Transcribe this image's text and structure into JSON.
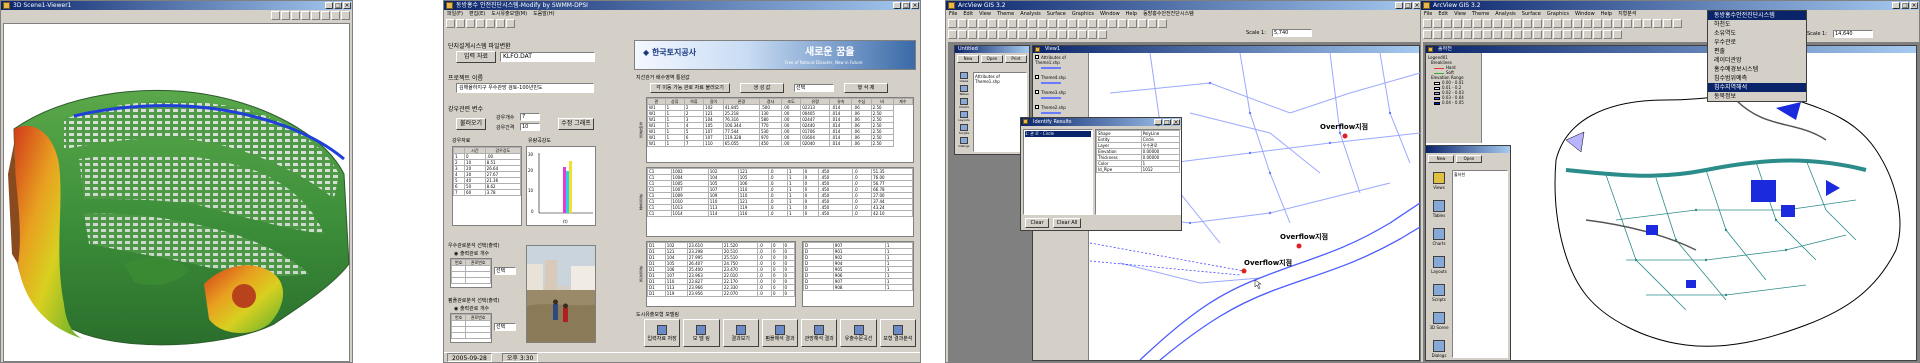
{
  "scene3d": {
    "title": "3D Scene1-Viewer1"
  },
  "swmm": {
    "title": "동방홍수 안전진단시스템-Modify by SWMM-DPSI",
    "menu": [
      "파일(F)",
      "편집(E)",
      "도시유출모델(M)",
      "도움말(H)"
    ],
    "input_section": "단지설계시스템 파일변환",
    "input_button": "입력 자료",
    "input_value": "KLFO.DAT",
    "project_name_label": "프로젝트 이름",
    "project_name_value": "김해율하지구 우수관망 검토-100년빈도",
    "rain_section": "강우관련 변수",
    "rain_load_button": "불러오기",
    "rain_count_label": "강우개수",
    "rain_count_value": "7",
    "rain_interval_label": "강우간격",
    "rain_interval_value": "10",
    "edit_graph_button": "수정 그래프",
    "rain_data_label": "강우자료",
    "rain_intensity_label": "유량곡강도",
    "rain_table_headers": [
      "",
      "시간",
      "강우강도"
    ],
    "rain_table_rows": [
      [
        "1",
        "0",
        ".00"
      ],
      [
        "2",
        "10",
        "8.51"
      ],
      [
        "3",
        "20",
        "26.64"
      ],
      [
        "4",
        "30",
        "27.67"
      ],
      [
        "5",
        "40",
        "21.36"
      ],
      [
        "6",
        "50",
        "8.62"
      ],
      [
        "7",
        "60",
        "3.78"
      ]
    ],
    "chart_xlabel": "(t)",
    "logo_text": "한국토지공사",
    "banner_slogan": "새로운 꿈을",
    "banner_sub": "Free of Natural Disaster, New in Future",
    "network_section": "지선관거 배수영역 통원값",
    "calc_button": "각 이동 가능 관로 자료 불러오기",
    "generate_button": "생 성 값",
    "select_value": "선택",
    "delete_button": "행 삭 제",
    "pipe_table_headers": [
      "관",
      "상류",
      "하류",
      "길이",
      "관경",
      "경사",
      "조도",
      "유량",
      "유속",
      "수심",
      "비",
      "계수"
    ],
    "pipe_rows": [
      [
        "W1",
        "1",
        "2",
        "102",
        "41.845",
        ".500",
        ".00",
        "02313",
        ".014",
        ".06",
        "2.50"
      ],
      [
        "W1",
        "1",
        "2",
        "121",
        "25.218",
        "130",
        ".00",
        "00405",
        ".014",
        ".06",
        "2.50"
      ],
      [
        "W1",
        "1",
        "3",
        "104",
        "76.316",
        "580",
        ".00",
        "02447",
        ".014",
        ".06",
        "2.50"
      ],
      [
        "W1",
        "1",
        "4",
        "105",
        "100.344",
        "770",
        ".00",
        "02440",
        ".014",
        ".06",
        "2.50"
      ],
      [
        "W1",
        "1",
        "5",
        "107",
        "77.544",
        "530",
        ".00",
        "01706",
        ".014",
        ".06",
        "2.50"
      ],
      [
        "W1",
        "1",
        "6",
        "107",
        "119.328",
        "970",
        ".00",
        "01604",
        ".014",
        ".06",
        "2.50"
      ],
      [
        "W1",
        "1",
        "7",
        "110",
        "65.055",
        "450",
        ".00",
        "02040",
        ".014",
        ".06",
        "2.50"
      ]
    ],
    "node_rows": [
      [
        "C1",
        "1002",
        "102",
        "121",
        ".0",
        "1",
        "0",
        ".450",
        ".0",
        "51.35"
      ],
      [
        "C1",
        "1004",
        "104",
        "105",
        ".0",
        "1",
        "0",
        ".450",
        ".0",
        "76.00"
      ],
      [
        "C1",
        "1005",
        "105",
        "106",
        ".0",
        "1",
        "0",
        ".450",
        ".0",
        "56.77"
      ],
      [
        "C1",
        "1007",
        "107",
        "110",
        ".0",
        "1",
        "0",
        ".450",
        ".0",
        "66.78"
      ],
      [
        "C1",
        "1009",
        "109",
        "110",
        ".0",
        "1",
        "0",
        ".450",
        ".0",
        "27.00"
      ],
      [
        "C1",
        "1010",
        "110",
        "121",
        ".0",
        "1",
        "0",
        ".450",
        ".0",
        "37.44"
      ],
      [
        "C1",
        "1013",
        "113",
        "119",
        ".0",
        "1",
        "0",
        ".450",
        ".0",
        "43.24"
      ],
      [
        "C1",
        "1014",
        "114",
        "116",
        ".0",
        "1",
        "0",
        ".450",
        ".0",
        "42.10"
      ]
    ],
    "out_rows": [
      [
        "D1",
        "102",
        "23.610",
        "21.520",
        ".0",
        "0",
        "0"
      ],
      [
        "D1",
        "121",
        "23.298",
        "20.510",
        ".0",
        "0",
        "0"
      ],
      [
        "D1",
        "104",
        "27.995",
        "25.510",
        ".0",
        "0",
        "0"
      ],
      [
        "D1",
        "105",
        "26.407",
        "24.750",
        ".0",
        "0",
        "0"
      ],
      [
        "D1",
        "106",
        "25.400",
        "23.470",
        ".0",
        "0",
        "0"
      ],
      [
        "D1",
        "107",
        "23.963",
        "22.010",
        ".0",
        "0",
        "0"
      ],
      [
        "D1",
        "110",
        "23.827",
        "22.170",
        ".0",
        "0",
        "0"
      ],
      [
        "D1",
        "113",
        "23.966",
        "22.330",
        ".0",
        "0",
        "0"
      ],
      [
        "D1",
        "119",
        "23.956",
        "22.070",
        ".0",
        "0",
        "0"
      ]
    ],
    "right_rows": [
      [
        "D",
        "907",
        "1"
      ],
      [
        "D",
        "901",
        "1"
      ],
      [
        "D",
        "902",
        "1"
      ],
      [
        "D",
        "904",
        "1"
      ],
      [
        "D",
        "905",
        "1"
      ],
      [
        "D",
        "906",
        "1"
      ],
      [
        "D",
        "907",
        "1"
      ],
      [
        "D",
        "908",
        "1"
      ]
    ],
    "outflow_section_a": "우수관로분석 선택(출력)",
    "outflow_radio_a": "출력관로 개수",
    "outflow_section_b": "펌플관로분석 선택(출력)",
    "outflow_radio_b": "출력관로 개수",
    "small_select_a": "선택",
    "small_select_b": "선택",
    "small_grid_headers": [
      "번호",
      "관로번호"
    ],
    "side_labels": [
      "주변관로",
      "관로유출",
      "관로자료"
    ],
    "bottom_section": "도시유출모형 모델링",
    "bottom_buttons": [
      "입력자료 저장",
      "모 델 링",
      "결과보기",
      "펌플해석 결과",
      "관망해석 결과",
      "유출수문곡선",
      "모형 결과분석"
    ],
    "status_date": "2005-09-28",
    "status_time": "오후 3:30"
  },
  "arcview1": {
    "title": "ArcView GIS 3.2",
    "menu": [
      "File",
      "Edit",
      "View",
      "Theme",
      "Analysis",
      "Surface",
      "Graphics",
      "Window",
      "Help",
      "동방홍수안전진단시스템"
    ],
    "scale_label": "Scale 1:",
    "scale_value": "5,740",
    "project_window_title": "Untitled",
    "project_buttons": [
      "New",
      "Open",
      "Print"
    ],
    "project_item": "Attributes of Theme1.shp",
    "project_icons": [
      "Views",
      "Tables",
      "Charts",
      "Layouts",
      "Scripts",
      "Dialogs"
    ],
    "view_title": "View1",
    "legend_items": [
      "Attributes of Theme1.shp",
      "Theme4.shp",
      "Theme3.shp",
      "Theme2.shp",
      "Theme1.shp"
    ],
    "identify_title": "Identify Results",
    "identify_list_item": "1: 관 로 - Circle",
    "identify_fields": [
      [
        "Shape",
        "PolyLine"
      ],
      [
        "Entity",
        "Circle"
      ],
      [
        "Layer",
        "우수관로"
      ],
      [
        "Elevation",
        "0.00000"
      ],
      [
        "Thickness",
        "0.00000"
      ],
      [
        "Color",
        "1"
      ],
      [
        "Id_Pipe",
        "1012"
      ]
    ],
    "identify_buttons": [
      "Clear",
      "Clear All"
    ],
    "overflow_labels": [
      "Overflow지점",
      "Overflow지점",
      "Overflow지점"
    ]
  },
  "arcview2": {
    "title": "ArcView GIS 3.2",
    "menu": [
      "File",
      "Edit",
      "View",
      "Theme",
      "Analysis",
      "Surface",
      "Graphics",
      "Window",
      "Help",
      "지형분석"
    ],
    "dropdown_title": "동방홍수안전진단시스템",
    "dropdown_items": [
      "하천도",
      "소유역도",
      "우수관로",
      "편출",
      "레이더관망",
      "홍수예경보시스템",
      "침수범위예측",
      "침수지역해석",
      "동북정보"
    ],
    "dropdown_selected_index": 7,
    "scale_label": "Scale 1:",
    "scale_value": "14,640",
    "view_title": "홀하천",
    "legend_title": "Legend01",
    "legend_sub": "Breaklines",
    "legend_items": [
      "Hard",
      "Soft"
    ],
    "elevation_title": "Elevation Range",
    "elevation_ranges": [
      "0.00 - 0.01",
      "0.01 - 0.2",
      "0.02 - 0.03",
      "0.03 - 0.04",
      "0.04 - 0.05"
    ],
    "elevation_colors": [
      "#ffffff",
      "#e4ecff",
      "#9bb4ff",
      "#4d6cff",
      "#001fd0"
    ],
    "project_buttons": [
      "New",
      "Open"
    ],
    "project_item": "홀하천",
    "project_icons": [
      "Views",
      "Tables",
      "Charts",
      "Layouts",
      "Scripts",
      "3D Scene",
      "Dialogs"
    ]
  }
}
